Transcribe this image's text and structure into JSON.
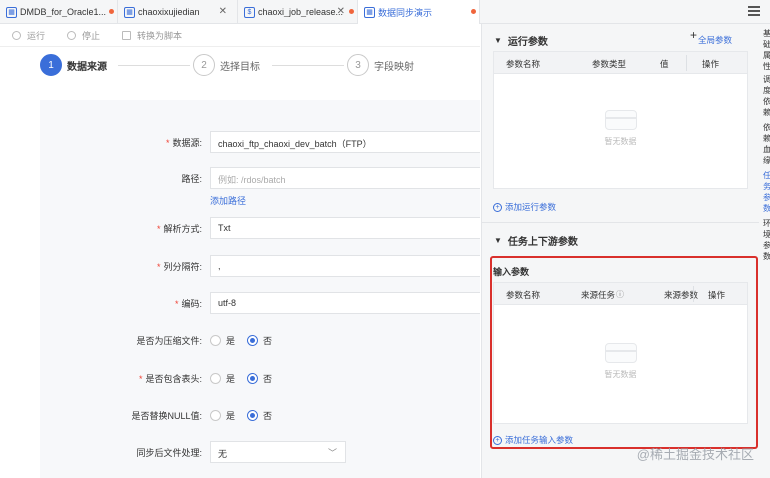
{
  "tabs": [
    {
      "label": "DMDB_for_Oracle1...",
      "icon": "table-icon",
      "closable": false,
      "modified": true
    },
    {
      "label": "chaoxixujiedian",
      "icon": "table-icon",
      "closable": true,
      "modified": false
    },
    {
      "label": "chaoxi_job_release...",
      "icon": "script-icon",
      "closable": true,
      "modified": true
    },
    {
      "label": "数据同步演示",
      "icon": "table-icon",
      "closable": false,
      "modified": true,
      "active": true
    }
  ],
  "toolbar": {
    "run": "运行",
    "stop": "停止",
    "convert": "转换为脚本"
  },
  "steps": [
    {
      "num": "1",
      "label": "数据来源",
      "active": true
    },
    {
      "num": "2",
      "label": "选择目标",
      "active": false
    },
    {
      "num": "3",
      "label": "字段映射",
      "active": false
    }
  ],
  "form": {
    "datasource": {
      "label": "数据源:",
      "value": "chaoxi_ftp_chaoxi_dev_batch（FTP）"
    },
    "path": {
      "label": "路径:",
      "placeholder": "例如: /rdos/batch",
      "add_link": "添加路径"
    },
    "parse_mode": {
      "label": "解析方式:",
      "value": "Txt"
    },
    "column_separator": {
      "label": "列分隔符:",
      "value": ","
    },
    "encoding": {
      "label": "编码:",
      "value": "utf-8"
    },
    "compressed": {
      "label": "是否为压缩文件:",
      "yes": "是",
      "no": "否",
      "selected": "no"
    },
    "has_header": {
      "label": "是否包含表头:",
      "yes": "是",
      "no": "否",
      "selected": "no"
    },
    "replace_null": {
      "label": "是否替换NULL值:",
      "yes": "是",
      "no": "否",
      "selected": "no"
    },
    "post_sync": {
      "label": "同步后文件处理:",
      "value": "无"
    }
  },
  "right_panel": {
    "run_params": {
      "title": "运行参数",
      "global_param_link": "全局参数",
      "columns": [
        "参数名称",
        "参数类型",
        "值",
        "操作"
      ],
      "empty_text": "暂无数据",
      "add_link": "添加运行参数"
    },
    "task_params": {
      "title": "任务上下游参数",
      "input_title": "输入参数",
      "columns": [
        "参数名称",
        "来源任务",
        "来源参数",
        "操作"
      ],
      "empty_text": "暂无数据",
      "add_link": "添加任务输入参数"
    }
  },
  "side_tabs": [
    "基础属性",
    "调度依赖",
    "依赖血缘",
    "任务参数",
    "环境参数"
  ],
  "watermark": "@稀土掘金技术社区",
  "colors": {
    "accent": "#3a6ed9",
    "highlight_border": "#d9302c",
    "required": "#f04134"
  }
}
